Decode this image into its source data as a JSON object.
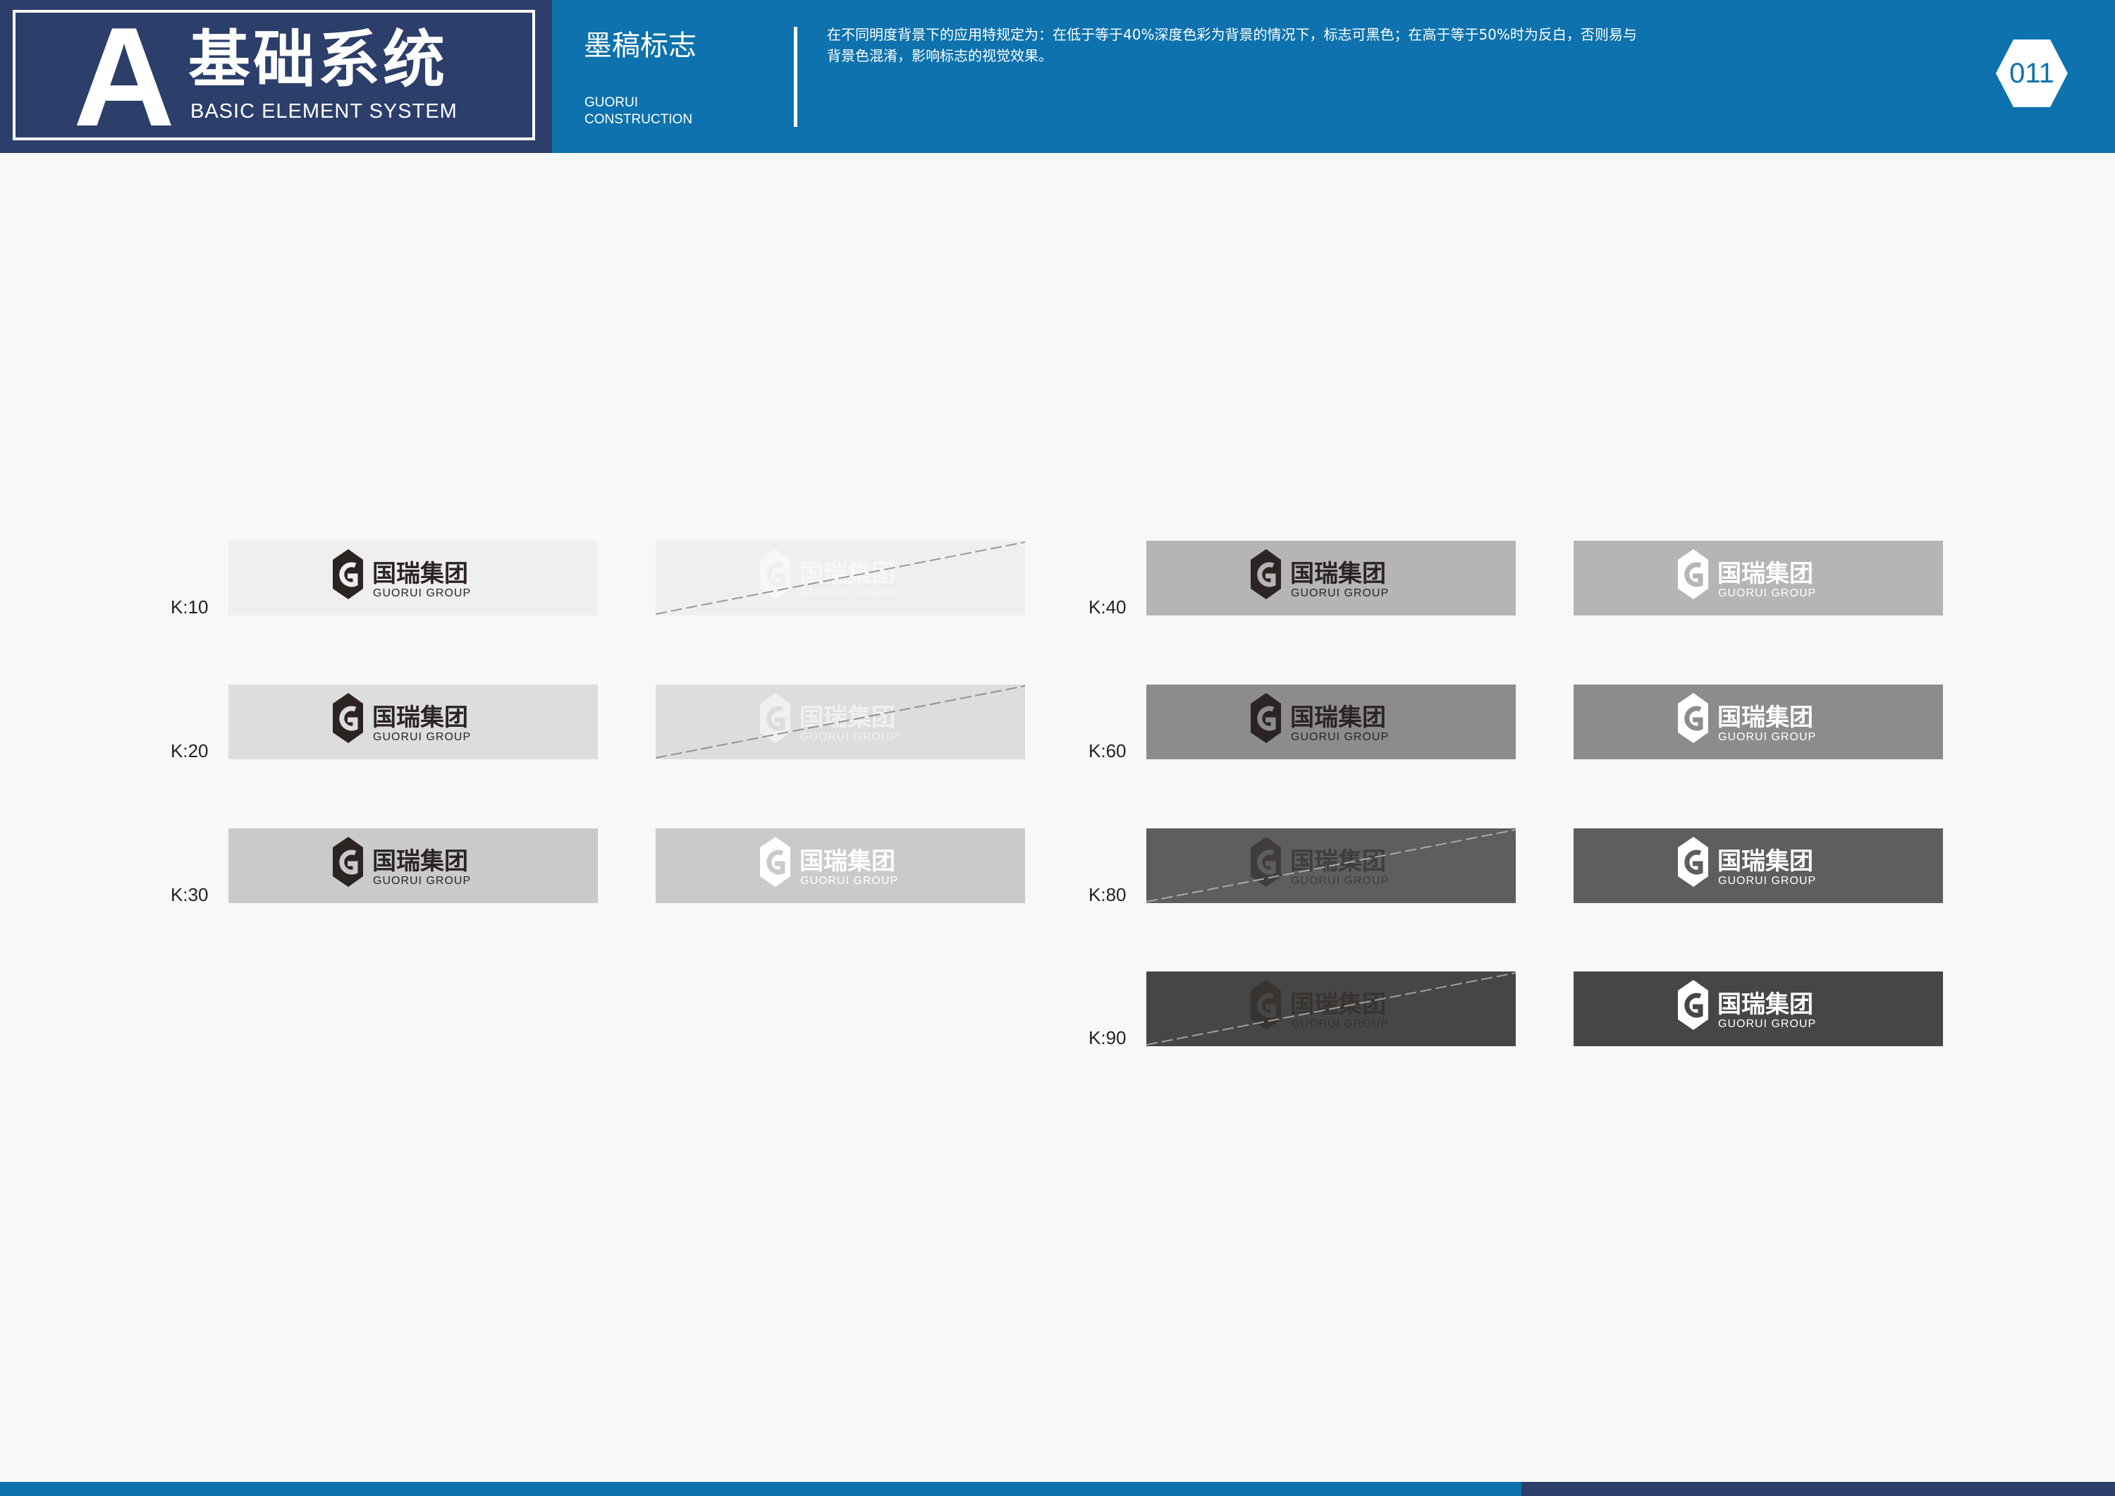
{
  "header": {
    "letter": "A",
    "section_title": "基础系统",
    "section_subtitle": "BASIC ELEMENT SYSTEM",
    "topic_title": "墨稿标志",
    "topic_en_line1": "GUORUI",
    "topic_en_line2": "CONSTRUCTION",
    "description_line1": "在不同明度背景下的应用特规定为：在低于等于40%深度色彩为背景的情况下，标志可黑色；在高于等于50%时为反白，否则易与",
    "description_line2": "背景色混淆，影响标志的视觉效果。",
    "page_number": "011"
  },
  "logo": {
    "cn": "国瑞集团",
    "en": "GUORUI GROUP"
  },
  "colors": {
    "header_blue": "#0d72ad",
    "header_navy": "#2c3e6a",
    "page_background": "#f8f8f8",
    "logo_dark": "#2b2423",
    "logo_light": "#ffffff"
  },
  "groups": [
    {
      "label": "K:10",
      "background": "#efefef",
      "tiles": [
        {
          "logo_color": "dark",
          "crossed": false
        },
        {
          "logo_color": "light",
          "crossed": true
        }
      ]
    },
    {
      "label": "K:20",
      "background": "#dcdedd",
      "tiles": [
        {
          "logo_color": "dark",
          "crossed": false
        },
        {
          "logo_color": "light",
          "crossed": true
        }
      ]
    },
    {
      "label": "K:30",
      "background": "#c9cbca",
      "tiles": [
        {
          "logo_color": "dark",
          "crossed": false
        },
        {
          "logo_color": "light",
          "crossed": false
        }
      ]
    },
    {
      "label": "K:40",
      "background": "#b5b5b5",
      "tiles": [
        {
          "logo_color": "dark",
          "crossed": false
        },
        {
          "logo_color": "light",
          "crossed": false
        }
      ]
    },
    {
      "label": "K:60",
      "background": "#8c8c8c",
      "tiles": [
        {
          "logo_color": "dark",
          "crossed": false
        },
        {
          "logo_color": "light",
          "crossed": false
        }
      ]
    },
    {
      "label": "K:80",
      "background": "#5e5d5f",
      "tiles": [
        {
          "logo_color": "dark",
          "crossed": true
        },
        {
          "logo_color": "light",
          "crossed": false
        }
      ]
    },
    {
      "label": "K:90",
      "background": "#474644",
      "tiles": [
        {
          "logo_color": "dark",
          "crossed": true
        },
        {
          "logo_color": "light",
          "crossed": false
        }
      ]
    }
  ]
}
